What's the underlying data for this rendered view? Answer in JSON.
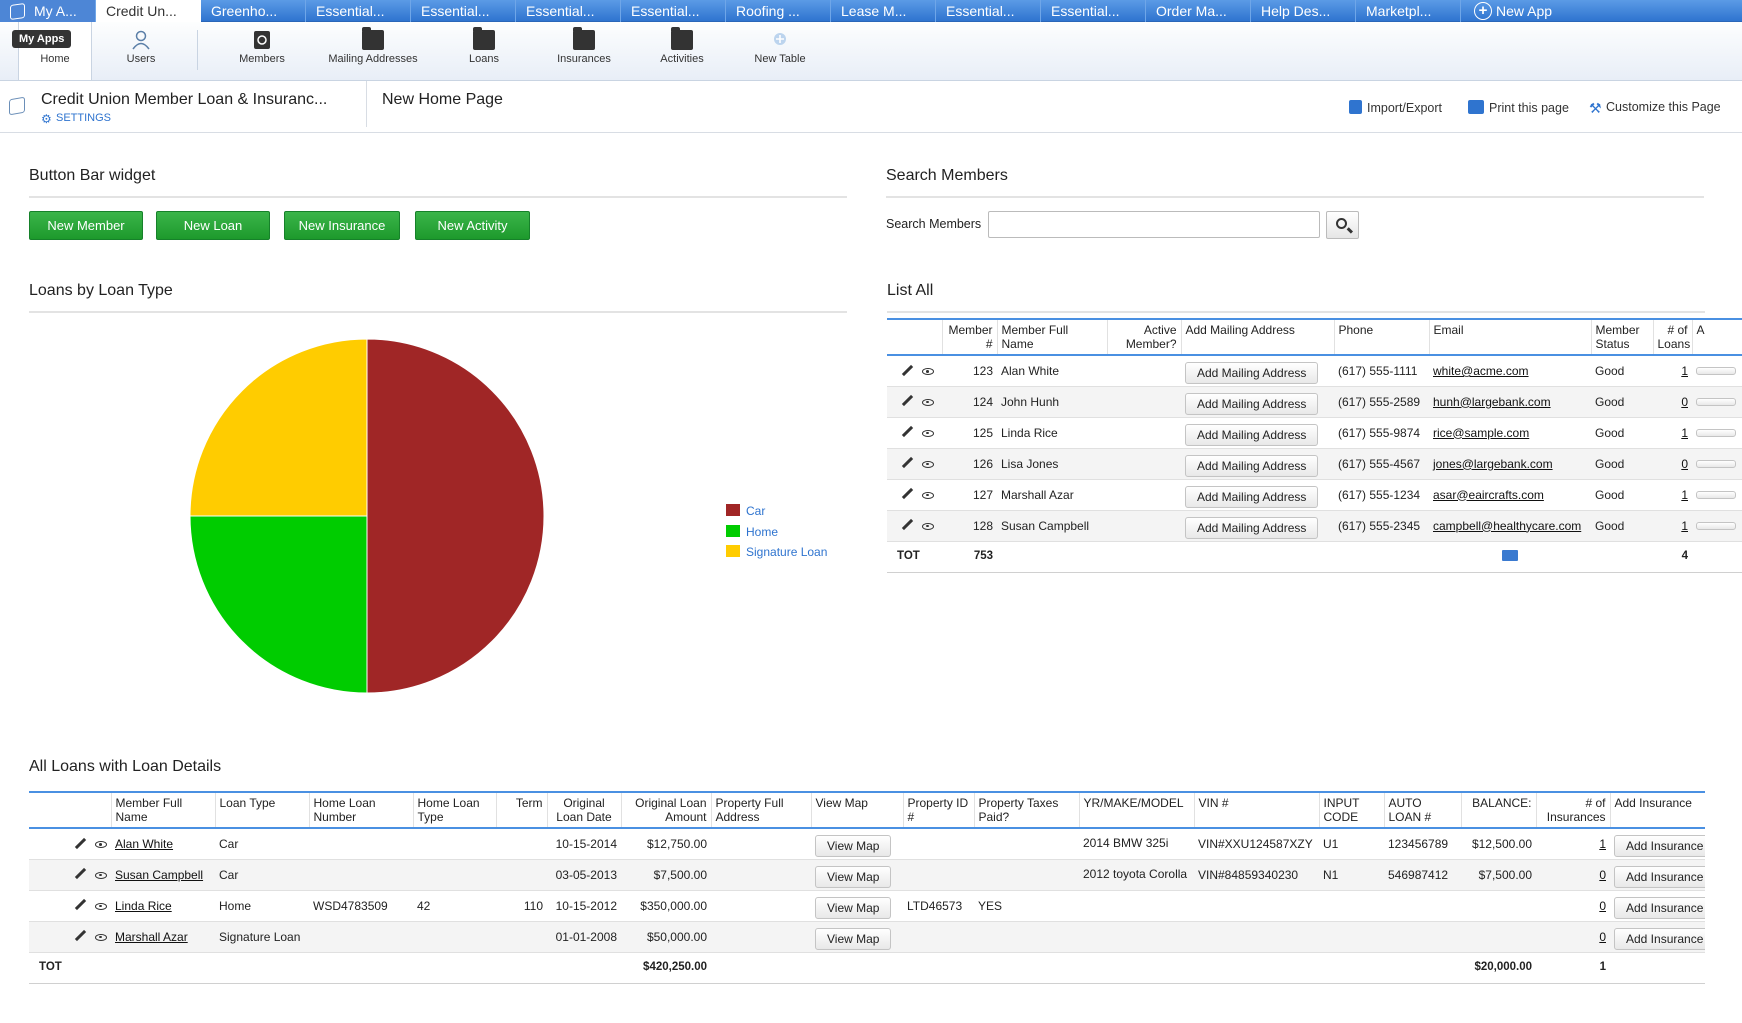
{
  "app_tabs": [
    {
      "label": "My A...",
      "active": false
    },
    {
      "label": "Credit Un...",
      "active": true
    },
    {
      "label": "Greenho...",
      "active": false
    },
    {
      "label": "Essential...",
      "active": false
    },
    {
      "label": "Essential...",
      "active": false
    },
    {
      "label": "Essential...",
      "active": false
    },
    {
      "label": "Essential...",
      "active": false
    },
    {
      "label": "Roofing ...",
      "active": false
    },
    {
      "label": "Lease M...",
      "active": false
    },
    {
      "label": "Essential...",
      "active": false
    },
    {
      "label": "Essential...",
      "active": false
    },
    {
      "label": "Order Ma...",
      "active": false
    },
    {
      "label": "Help Des...",
      "active": false
    },
    {
      "label": "Marketpl...",
      "active": false
    },
    {
      "label": "New App",
      "active": false
    }
  ],
  "tooltip": "My Apps",
  "toolbar": {
    "items": [
      "Home",
      "Users",
      "Members",
      "Mailing Addresses",
      "Loans",
      "Insurances",
      "Activities",
      "New Table"
    ]
  },
  "breadcrumb": {
    "app_name": "Credit Union Member Loan &  Insuranc...",
    "settings": "SETTINGS",
    "page": "New Home Page",
    "actions": [
      "Import/Export",
      "Print this page",
      "Customize this Page"
    ]
  },
  "button_bar": {
    "title": "Button Bar widget",
    "buttons": [
      "New Member",
      "New Loan",
      "New Insurance",
      "New Activity"
    ]
  },
  "search": {
    "title": "Search Members",
    "label": "Search Members",
    "value": ""
  },
  "colors": {
    "car": "#a02626",
    "home": "#00cc00",
    "signature": "#ffcc00",
    "accent": "#4a90e2",
    "green_button": "#1d9a2c"
  },
  "pie": {
    "title": "Loans by Loan Type",
    "chart_data": {
      "type": "pie",
      "categories": [
        "Car",
        "Home",
        "Signature Loan"
      ],
      "values": [
        2,
        1,
        1
      ]
    }
  },
  "list_all": {
    "title": "List All",
    "headers": [
      "Member #",
      "Member Full Name",
      "Active Member?",
      "Add Mailing Address",
      "Phone",
      "Email",
      "Member Status",
      "# of Loans",
      "A"
    ],
    "rows": [
      {
        "num": "123",
        "name": "Alan  White",
        "button": "Add  Mailing Address",
        "phone": "(617) 555-1111",
        "email": "white@acme.com",
        "status": "Good",
        "loans": "1"
      },
      {
        "num": "124",
        "name": "John  Hunh",
        "button": "Add  Mailing Address",
        "phone": "(617) 555-2589",
        "email": "hunh@largebank.com",
        "status": "Good",
        "loans": "0"
      },
      {
        "num": "125",
        "name": "Linda  Rice",
        "button": "Add  Mailing Address",
        "phone": "(617) 555-9874",
        "email": "rice@sample.com",
        "status": "Good",
        "loans": "1"
      },
      {
        "num": "126",
        "name": "Lisa  Jones",
        "button": "Add  Mailing Address",
        "phone": "(617) 555-4567",
        "email": "jones@largebank.com",
        "status": "Good",
        "loans": "0"
      },
      {
        "num": "127",
        "name": "Marshall  Azar",
        "button": "Add  Mailing Address",
        "phone": "(617) 555-1234",
        "email": "asar@eaircrafts.com",
        "status": "Good",
        "loans": "1"
      },
      {
        "num": "128",
        "name": "Susan  Campbell",
        "button": "Add  Mailing Address",
        "phone": "(617) 555-2345",
        "email": "campbell@healthycare.com",
        "status": "Good",
        "loans": "1"
      }
    ],
    "total": {
      "label": "TOT",
      "num": "753",
      "loans": "4"
    }
  },
  "loans": {
    "title": "All Loans with Loan Details",
    "headers": [
      "Member Full Name",
      "Loan Type",
      "Home Loan Number",
      "Home Loan Type",
      "Term",
      "Original Loan Date",
      "Original Loan Amount",
      "Property Full Address",
      "View Map",
      "Property ID #",
      "Property Taxes Paid?",
      "YR/MAKE/MODEL",
      "VIN #",
      "INPUT CODE",
      "AUTO LOAN #",
      "BALANCE:",
      "# of Insurances",
      "Add Insurance"
    ],
    "rows": [
      {
        "name": "Alan  White",
        "type": "Car",
        "hln": "",
        "hlt": "",
        "term": "",
        "date": "10-15-2014",
        "amount": "$12,750.00",
        "map": "View Map",
        "pid": "",
        "taxes": "",
        "ymm": "2014 BMW 325i",
        "vin": "VIN#XXU124587XZY",
        "code": "U1",
        "auto": "123456789",
        "balance": "$12,500.00",
        "ins": "1",
        "add": "Add  Insurance"
      },
      {
        "name": "Susan  Campbell",
        "type": "Car",
        "hln": "",
        "hlt": "",
        "term": "",
        "date": "03-05-2013",
        "amount": "$7,500.00",
        "map": "View Map",
        "pid": "",
        "taxes": "",
        "ymm": "2012 toyota Corolla",
        "vin": "VIN#84859340230",
        "code": "N1",
        "auto": "546987412",
        "balance": "$7,500.00",
        "ins": "0",
        "add": "Add  Insurance"
      },
      {
        "name": "Linda  Rice",
        "type": "Home",
        "hln": "WSD4783509",
        "hlt": "42",
        "term": "110",
        "date": "10-15-2012",
        "amount": "$350,000.00",
        "map": "View Map",
        "pid": "LTD46573",
        "taxes": "YES",
        "ymm": "",
        "vin": "",
        "code": "",
        "auto": "",
        "balance": "",
        "ins": "0",
        "add": "Add  Insurance"
      },
      {
        "name": "Marshall  Azar",
        "type": "Signature Loan",
        "hln": "",
        "hlt": "",
        "term": "",
        "date": "01-01-2008",
        "amount": "$50,000.00",
        "map": "View Map",
        "pid": "",
        "taxes": "",
        "ymm": "",
        "vin": "",
        "code": "",
        "auto": "",
        "balance": "",
        "ins": "0",
        "add": "Add  Insurance"
      }
    ],
    "total": {
      "label": "TOT",
      "amount": "$420,250.00",
      "balance": "$20,000.00",
      "ins": "1"
    }
  }
}
